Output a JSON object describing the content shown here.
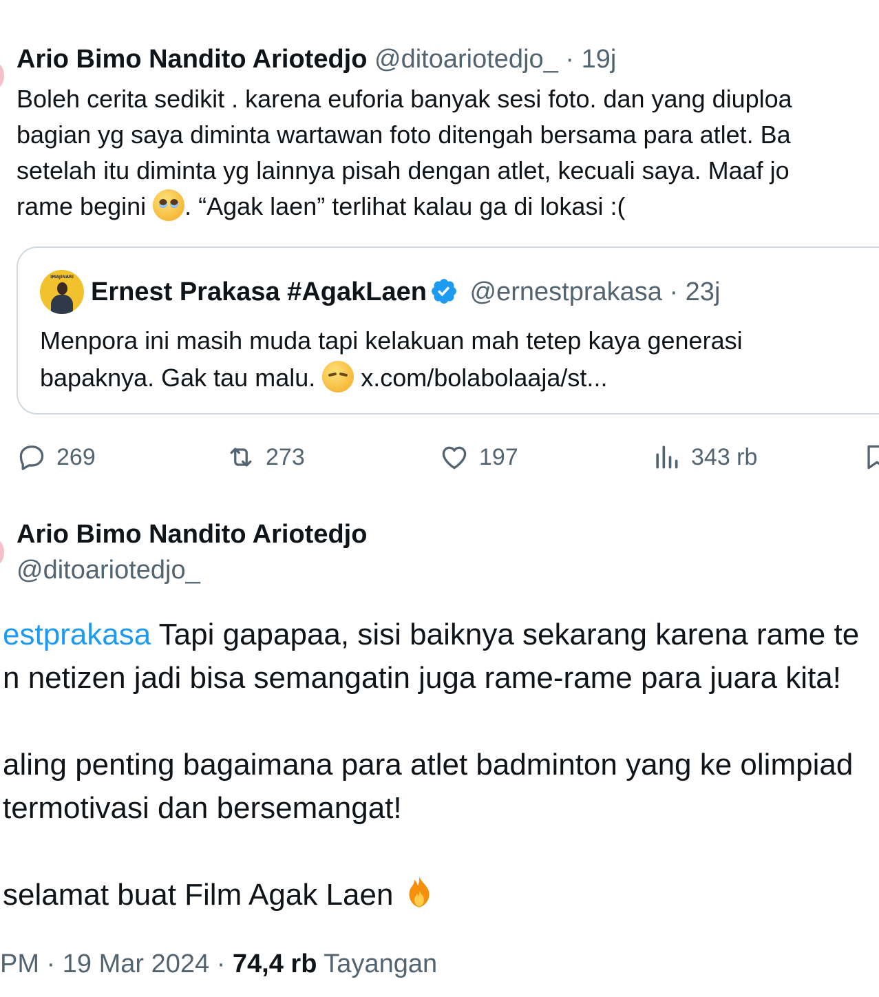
{
  "colors": {
    "text": "#0f1419",
    "secondary": "#536471",
    "link": "#1d9bf0",
    "border": "#cfd9de",
    "verified": "#1d9bf0"
  },
  "tweet1": {
    "author_name": "Ario Bimo Nandito Ariotedjo",
    "handle": "@ditoariotedjo_",
    "separator": "·",
    "time": "19j",
    "text_lines": [
      "Boleh cerita sedikit . karena euforia banyak sesi foto. dan yang  diuploa",
      "bagian yg saya diminta wartawan foto ditengah bersama  para atlet. Ba",
      "setelah itu diminta yg lainnya pisah dengan atlet, kecuali saya. Maaf  jo"
    ],
    "text_last_before_emoji": "rame begini ",
    "emoji_1": "pleading-face-emoji",
    "text_last_after_emoji": ". “Agak laen” terlihat kalau ga di lokasi  :(",
    "quoted": {
      "avatar_caption": "IMAJINARI",
      "author_name": "Ernest Prakasa #AgakLaen",
      "verified_icon": "verified-badge-icon",
      "handle": "@ernestprakasa",
      "separator": "·",
      "time": "23j",
      "text_line1": "Menpora ini masih muda tapi kelakuan mah tetep kaya generasi",
      "text_line2_before_emoji": "bapaknya. Gak tau malu. ",
      "emoji": "pensive-face-emoji",
      "link": " x.com/bolabolaaja/st..."
    },
    "actions": {
      "replies": "269",
      "reposts": "273",
      "likes": "197",
      "views": "343 rb"
    }
  },
  "tweet2": {
    "author_name": "Ario Bimo Nandito Ariotedjo",
    "handle": "@ditoariotedjo_",
    "mention": "estprakasa",
    "line1_text": " Tapi gapapaa, sisi baiknya sekarang karena rame te",
    "line2": "n netizen jadi bisa semangatin juga rame-rame para juara kita!",
    "line3": "aling penting bagaimana para atlet badminton yang ke olimpiad",
    "line4": " termotivasi dan bersemangat!",
    "line5_text": "selamat buat Film Agak Laen ",
    "line5_emoji": "fire-emoji",
    "meta_time": "PM · 19 Mar 2024 · ",
    "meta_views_count": "74,4 rb",
    "meta_views_label": " Tayangan"
  }
}
